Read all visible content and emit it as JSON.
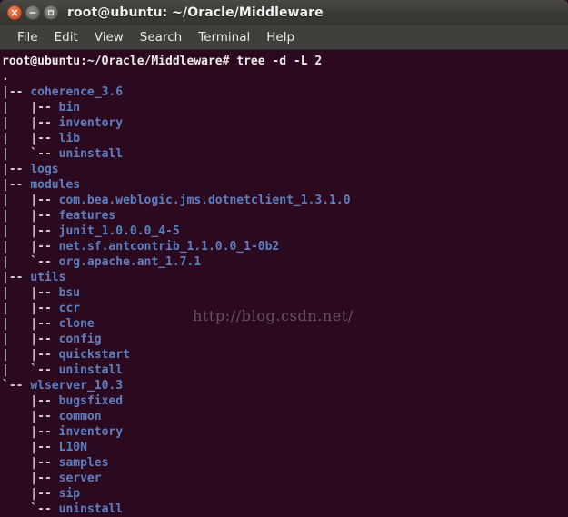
{
  "window": {
    "title": "root@ubuntu: ~/Oracle/Middleware",
    "controls": [
      {
        "name": "close",
        "glyph": "×"
      },
      {
        "name": "minimize",
        "glyph": "−"
      },
      {
        "name": "maximize",
        "glyph": "□"
      }
    ],
    "colors": {
      "titlebar": "#3b3936",
      "menubar": "#413f3b",
      "terminal_bg": "#2b0a1f",
      "text": "#d8d4d0",
      "directory": "#5f7fc0",
      "close_button": "#e2633a",
      "watermark": "#8d8188"
    }
  },
  "menu": {
    "items": [
      {
        "label": "File"
      },
      {
        "label": "Edit"
      },
      {
        "label": "View"
      },
      {
        "label": "Search"
      },
      {
        "label": "Terminal"
      },
      {
        "label": "Help"
      }
    ]
  },
  "terminal": {
    "prompt": "root@ubuntu:~/Oracle/Middleware# ",
    "command": "tree -d -L 2",
    "watermark": "http://blog.csdn.net/",
    "lines": [
      {
        "type": "prompt",
        "prompt": "root@ubuntu:~/Oracle/Middleware# ",
        "command": "tree -d -L 2"
      },
      {
        "type": "tree",
        "branch": ".",
        "name": ""
      },
      {
        "type": "tree",
        "branch": "|-- ",
        "name": "coherence_3.6"
      },
      {
        "type": "tree",
        "branch": "|   |-- ",
        "name": "bin"
      },
      {
        "type": "tree",
        "branch": "|   |-- ",
        "name": "inventory"
      },
      {
        "type": "tree",
        "branch": "|   |-- ",
        "name": "lib"
      },
      {
        "type": "tree",
        "branch": "|   `-- ",
        "name": "uninstall"
      },
      {
        "type": "tree",
        "branch": "|-- ",
        "name": "logs"
      },
      {
        "type": "tree",
        "branch": "|-- ",
        "name": "modules"
      },
      {
        "type": "tree",
        "branch": "|   |-- ",
        "name": "com.bea.weblogic.jms.dotnetclient_1.3.1.0"
      },
      {
        "type": "tree",
        "branch": "|   |-- ",
        "name": "features"
      },
      {
        "type": "tree",
        "branch": "|   |-- ",
        "name": "junit_1.0.0.0_4-5"
      },
      {
        "type": "tree",
        "branch": "|   |-- ",
        "name": "net.sf.antcontrib_1.1.0.0_1-0b2"
      },
      {
        "type": "tree",
        "branch": "|   `-- ",
        "name": "org.apache.ant_1.7.1"
      },
      {
        "type": "tree",
        "branch": "|-- ",
        "name": "utils"
      },
      {
        "type": "tree",
        "branch": "|   |-- ",
        "name": "bsu"
      },
      {
        "type": "tree",
        "branch": "|   |-- ",
        "name": "ccr"
      },
      {
        "type": "tree",
        "branch": "|   |-- ",
        "name": "clone"
      },
      {
        "type": "tree",
        "branch": "|   |-- ",
        "name": "config"
      },
      {
        "type": "tree",
        "branch": "|   |-- ",
        "name": "quickstart"
      },
      {
        "type": "tree",
        "branch": "|   `-- ",
        "name": "uninstall"
      },
      {
        "type": "tree",
        "branch": "`-- ",
        "name": "wlserver_10.3"
      },
      {
        "type": "tree",
        "branch": "    |-- ",
        "name": "bugsfixed"
      },
      {
        "type": "tree",
        "branch": "    |-- ",
        "name": "common"
      },
      {
        "type": "tree",
        "branch": "    |-- ",
        "name": "inventory"
      },
      {
        "type": "tree",
        "branch": "    |-- ",
        "name": "L10N"
      },
      {
        "type": "tree",
        "branch": "    |-- ",
        "name": "samples"
      },
      {
        "type": "tree",
        "branch": "    |-- ",
        "name": "server"
      },
      {
        "type": "tree",
        "branch": "    |-- ",
        "name": "sip"
      },
      {
        "type": "tree",
        "branch": "    `-- ",
        "name": "uninstall"
      }
    ]
  }
}
